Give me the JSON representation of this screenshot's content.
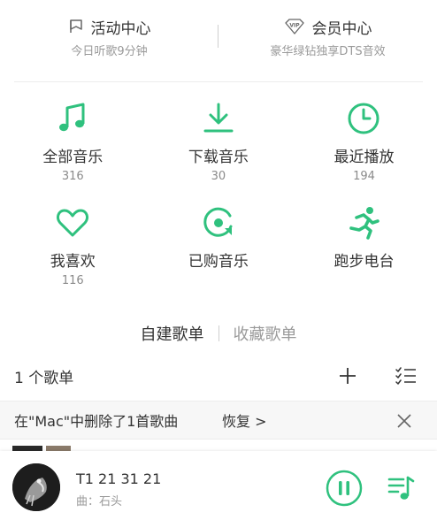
{
  "colors": {
    "accent": "#2fc17e",
    "text": "#333333",
    "muted": "#9a9a9a"
  },
  "top": {
    "activity": {
      "icon": "flag-icon",
      "title": "活动中心",
      "subtitle": "今日听歌9分钟"
    },
    "vip": {
      "icon": "vip-diamond-icon",
      "title": "会员中心",
      "subtitle": "豪华绿钻独享DTS音效"
    }
  },
  "grid": [
    {
      "key": "all-music",
      "icon": "music-note-icon",
      "label": "全部音乐",
      "count": "316"
    },
    {
      "key": "download",
      "icon": "download-icon",
      "label": "下载音乐",
      "count": "30"
    },
    {
      "key": "recent",
      "icon": "clock-icon",
      "label": "最近播放",
      "count": "194"
    },
    {
      "key": "favorites",
      "icon": "heart-icon",
      "label": "我喜欢",
      "count": "116"
    },
    {
      "key": "purchased",
      "icon": "purchased-disc-icon",
      "label": "已购音乐",
      "count": ""
    },
    {
      "key": "running",
      "icon": "running-icon",
      "label": "跑步电台",
      "count": ""
    }
  ],
  "playlist_tabs": {
    "created": "自建歌单",
    "collected": "收藏歌单"
  },
  "playlist_header": {
    "count_label": "1 个歌单"
  },
  "notice": {
    "text": "在\"Mac\"中删除了1首歌曲",
    "undo": "恢复 >"
  },
  "player": {
    "title": "T1 21 31 21",
    "artist": "曲：石头",
    "state": "playing"
  }
}
